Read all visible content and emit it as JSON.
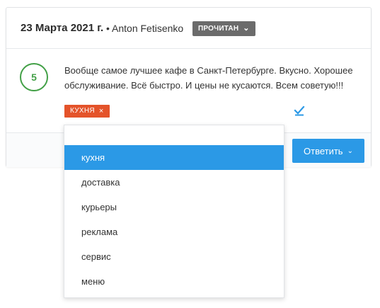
{
  "review": {
    "date": "23 Марта 2021 г.",
    "author": "• Anton Fetisenko",
    "status": "ПРОЧИТАН",
    "rating": "5",
    "text": "Вообще самое лучшее кафе в Санкт-Петербурге. Вкусно. Хорошее обслуживание. Всё быстро. И цены не кусаются. Всем советую!!!",
    "tags": [
      {
        "label": "КУХНЯ",
        "remove_icon": "×"
      }
    ],
    "reply_label": "Ответить"
  },
  "dropdown": {
    "input_value": "",
    "options": [
      {
        "label": "кухня",
        "selected": true
      },
      {
        "label": "доставка",
        "selected": false
      },
      {
        "label": "курьеры",
        "selected": false
      },
      {
        "label": "реклама",
        "selected": false
      },
      {
        "label": "сервис",
        "selected": false
      },
      {
        "label": "меню",
        "selected": false
      }
    ]
  },
  "colors": {
    "accent": "#2b99e6",
    "tag": "#e4532a",
    "rating": "#43a047",
    "status_bg": "#6b6b6b"
  },
  "icons": {
    "status_chevron": "chevron-down-icon",
    "reply_chevron": "chevron-down-icon",
    "check": "check-underline-icon",
    "tag_remove": "close-icon"
  }
}
